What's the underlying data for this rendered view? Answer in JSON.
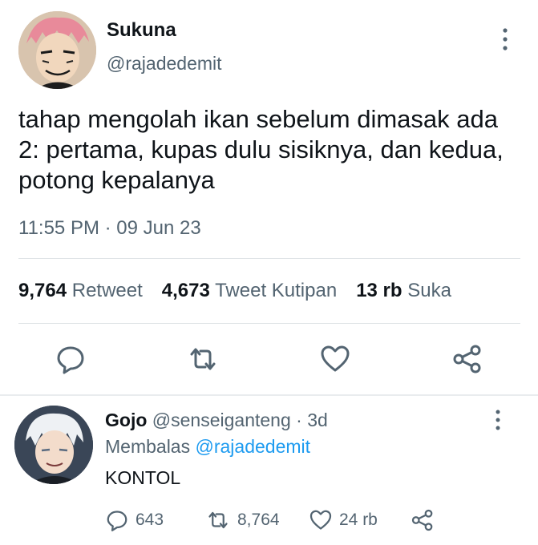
{
  "tweet": {
    "display_name": "Sukuna",
    "handle": "@rajadedemit",
    "text": "tahap mengolah ikan sebelum dimasak ada 2: pertama, kupas dulu sisiknya, dan kedua, potong kepalanya",
    "time": "11:55 PM",
    "dot": "·",
    "date": "09 Jun 23",
    "stats": {
      "retweets_count": "9,764",
      "retweets_label": "Retweet",
      "quotes_count": "4,673",
      "quotes_label": "Tweet Kutipan",
      "likes_count": "13 rb",
      "likes_label": "Suka"
    },
    "actions": [
      "reply-icon",
      "retweet-icon",
      "like-icon",
      "share-icon"
    ]
  },
  "reply": {
    "display_name": "Gojo",
    "handle": "@senseiganteng",
    "dot": "·",
    "age": "3d",
    "replying_label": "Membalas",
    "replying_to": "@rajadedemit",
    "text": "KONTOL",
    "counts": {
      "replies": "643",
      "retweets": "8,764",
      "likes": "24 rb"
    }
  },
  "colors": {
    "text": "#0f1419",
    "secondary": "#536471",
    "link": "#1d9bf0",
    "divider": "#dfe3e6"
  }
}
